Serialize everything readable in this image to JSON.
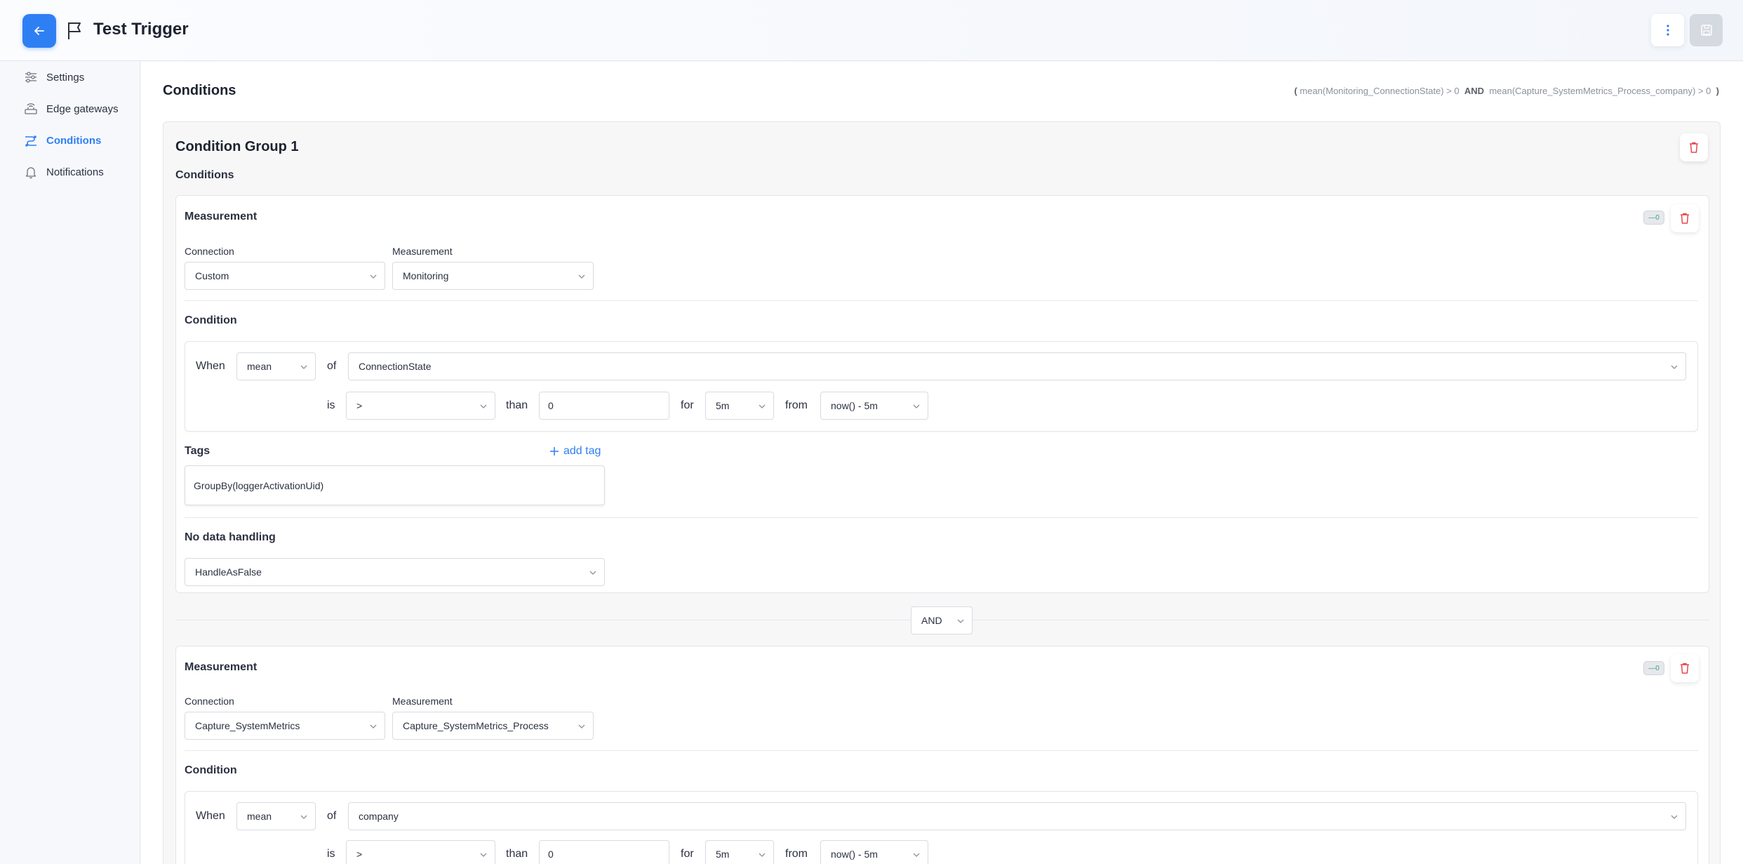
{
  "header": {
    "title": "Test Trigger"
  },
  "sidebar": {
    "items": [
      {
        "label": "Settings",
        "icon": "sliders-icon"
      },
      {
        "label": "Edge gateways",
        "icon": "gateway-icon"
      },
      {
        "label": "Conditions",
        "icon": "conditions-icon",
        "active": true
      },
      {
        "label": "Notifications",
        "icon": "bell-icon"
      }
    ]
  },
  "main": {
    "title": "Conditions",
    "expression": {
      "open": "(",
      "left": "mean(Monitoring_ConnectionState) > 0",
      "op": "AND",
      "right": "mean(Capture_SystemMetrics_Process_company) > 0",
      "close": ")"
    },
    "group": {
      "title": "Condition Group 1",
      "subtitle": "Conditions",
      "join_operator": "AND",
      "measurements": [
        {
          "title": "Measurement",
          "connection_label": "Connection",
          "connection_value": "Custom",
          "measurement_label": "Measurement",
          "measurement_value": "Monitoring",
          "condition_title": "Condition",
          "when_label": "When",
          "aggregate": "mean",
          "of_label": "of",
          "field": "ConnectionState",
          "is_label": "is",
          "operator": ">",
          "than_label": "than",
          "threshold": "0",
          "for_label": "for",
          "duration": "5m",
          "from_label": "from",
          "from_value": "now() - 5m",
          "tags_title": "Tags",
          "add_tag_label": "add tag",
          "tag": "GroupBy(loggerActivationUid)",
          "nodata_title": "No data handling",
          "nodata_value": "HandleAsFalse"
        },
        {
          "title": "Measurement",
          "connection_label": "Connection",
          "connection_value": "Capture_SystemMetrics",
          "measurement_label": "Measurement",
          "measurement_value": "Capture_SystemMetrics_Process",
          "condition_title": "Condition",
          "when_label": "When",
          "aggregate": "mean",
          "of_label": "of",
          "field": "company",
          "is_label": "is",
          "operator": ">",
          "than_label": "than",
          "threshold": "0",
          "for_label": "for",
          "duration": "5m",
          "from_label": "from",
          "from_value": "now() - 5m"
        }
      ]
    }
  },
  "colors": {
    "accent": "#2f7ff4",
    "danger": "#e5484d",
    "toggle_text": "#3aa17e"
  }
}
